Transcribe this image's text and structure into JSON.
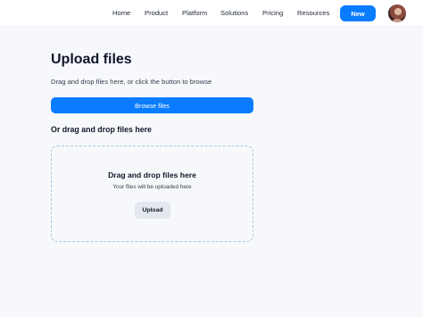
{
  "nav": {
    "items": [
      "Home",
      "Product",
      "Platform",
      "Solutions",
      "Pricing",
      "Resources"
    ],
    "new_button": "New",
    "avatar_icon": "user-avatar"
  },
  "page": {
    "title": "Upload files",
    "subtitle": "Drag and drop files here, or click the button to browse",
    "browse_button": "Browse files",
    "section_heading": "Or drag and drop files here"
  },
  "dropzone": {
    "title": "Drag and drop files here",
    "subtitle": "Your files will be uploaded here",
    "upload_button": "Upload"
  },
  "colors": {
    "accent": "#0a7cff",
    "background": "#f6f8fb",
    "dropzone_border": "#a9c9e6",
    "secondary_button": "#e3e8ee"
  }
}
